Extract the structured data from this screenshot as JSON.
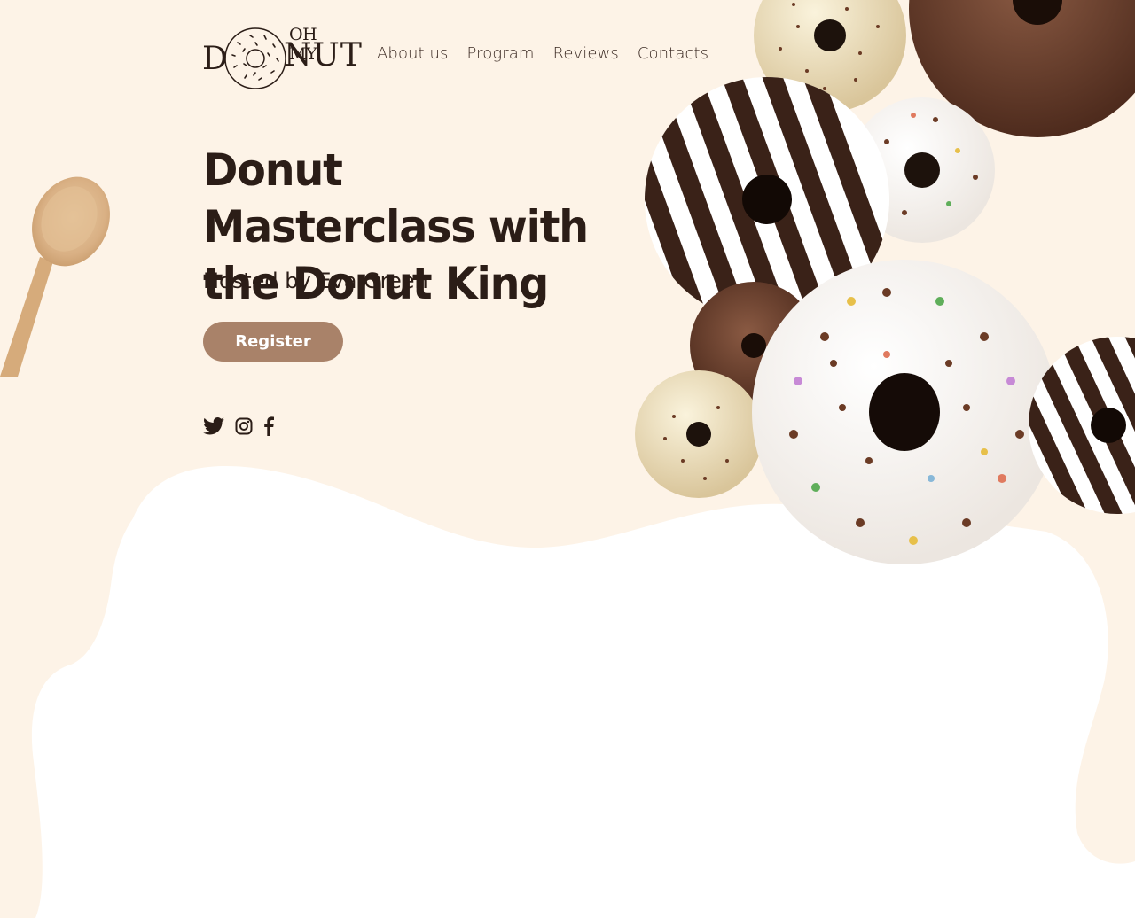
{
  "brand": {
    "logo_top": "OH MY",
    "logo_d": "D",
    "logo_bottom": "NUT"
  },
  "nav": {
    "items": [
      {
        "label": "About us"
      },
      {
        "label": "Program"
      },
      {
        "label": "Reviews"
      },
      {
        "label": "Contacts"
      }
    ]
  },
  "hero": {
    "title": "Donut Masterclass with the Donut King",
    "subtitle": "Hosted by Eva Green",
    "register_label": "Register"
  },
  "social": {
    "icons": [
      "twitter-icon",
      "instagram-icon",
      "facebook-icon"
    ]
  },
  "colors": {
    "background": "#fdf3e7",
    "text": "#2b1d17",
    "button": "#a98269",
    "button_text": "#ffffff",
    "white_wave": "#ffffff"
  }
}
